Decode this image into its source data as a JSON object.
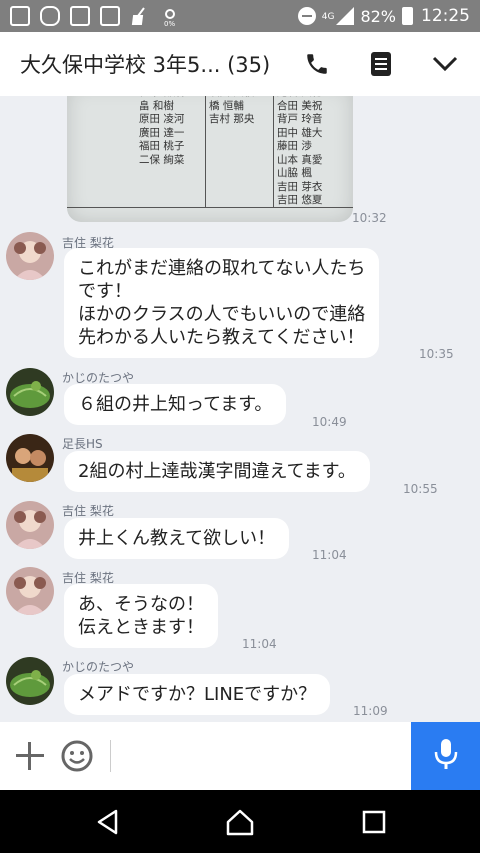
{
  "status_bar": {
    "network": "4G",
    "battery": "82%",
    "time": "12:25"
  },
  "header": {
    "title": "大久保中学校 3年5... (35)",
    "icons": [
      "phone-icon",
      "menu-icon",
      "chevron-down-icon"
    ]
  },
  "photo": {
    "columns": [
      "桂木 部磨\n畠 和樹\n原田 凌河\n廣田 達一\n福田 桃子\n二保 絢菜",
      "濱田 美桜\n橋 恒輔\n吉村 那央",
      "尾石 美穂\n合田 美祝\n背戸 玲音\n田中 雄大\n藤田 渉\n山本 真愛\n山脇 楓\n吉田 芽衣\n吉田 悠夏"
    ],
    "timestamp": "10:32"
  },
  "messages": [
    {
      "sender": "吉住 梨花",
      "text": "これがまだ連絡の取れてない人たち\nです！\nほかのクラスの人でもいいので連絡\n先わかる人いたら教えてください！",
      "time": "10:35"
    },
    {
      "sender": "かじのたつや",
      "text": "６組の井上知ってます。",
      "time": "10:49"
    },
    {
      "sender": "足長HS",
      "text": "2組の村上達哉漢字間違えてます。",
      "time": "10:55"
    },
    {
      "sender": "吉住 梨花",
      "text": "井上くん教えて欲しい！",
      "time": "11:04"
    },
    {
      "sender": "吉住 梨花",
      "text": "あ、そうなの！\n伝えときます！",
      "time": "11:04"
    },
    {
      "sender": "かじのたつや",
      "text": "メアドですか？LINEですか？",
      "time": "11:09"
    }
  ],
  "input_bar": {
    "icons": [
      "plus-icon",
      "smile-icon",
      "mic-icon"
    ],
    "accent": "#2a7cf2"
  },
  "nav_bar": {
    "icons": [
      "back-icon",
      "home-icon",
      "recents-icon"
    ]
  }
}
